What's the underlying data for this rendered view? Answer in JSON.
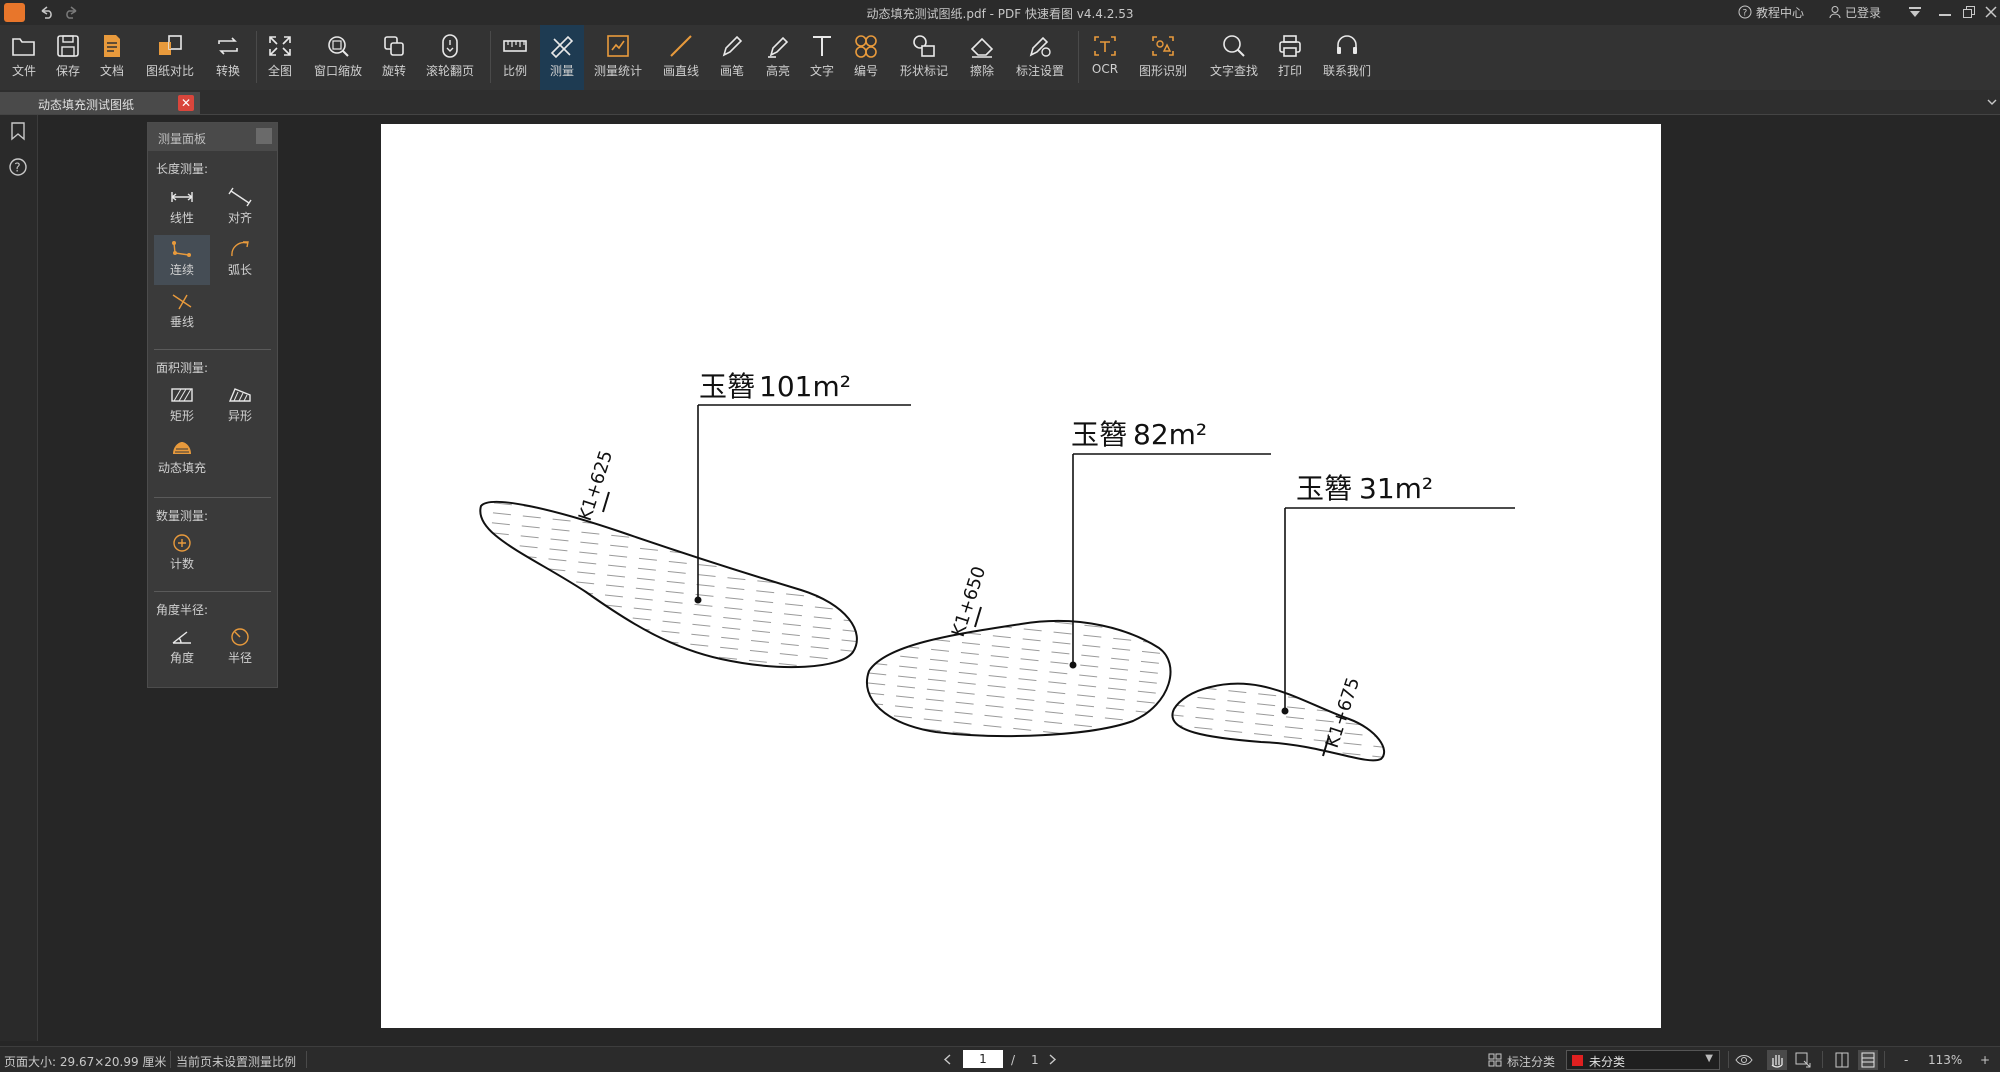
{
  "app": {
    "title": "动态填充测试图纸.pdf - PDF 快速看图 v4.4.2.53",
    "tutorial_label": "教程中心",
    "login_label": "已登录"
  },
  "toolbar": {
    "items": [
      {
        "label": "文件",
        "icon": "folder-icon"
      },
      {
        "label": "保存",
        "icon": "save-icon"
      },
      {
        "label": "文档",
        "icon": "document-icon"
      },
      {
        "label": "图纸对比",
        "icon": "compare-icon"
      },
      {
        "label": "转换",
        "icon": "convert-icon"
      },
      {
        "label": "全图",
        "icon": "fit-all-icon"
      },
      {
        "label": "窗口缩放",
        "icon": "zoom-window-icon"
      },
      {
        "label": "旋转",
        "icon": "rotate-icon"
      },
      {
        "label": "滚轮翻页",
        "icon": "mouse-wheel-icon"
      },
      {
        "label": "比例",
        "icon": "ruler-icon"
      },
      {
        "label": "测量",
        "icon": "measure-icon"
      },
      {
        "label": "测量统计",
        "icon": "measure-stats-icon"
      },
      {
        "label": "画直线",
        "icon": "line-icon"
      },
      {
        "label": "画笔",
        "icon": "pen-icon"
      },
      {
        "label": "高亮",
        "icon": "highlighter-icon"
      },
      {
        "label": "文字",
        "icon": "text-icon"
      },
      {
        "label": "编号",
        "icon": "numbering-icon"
      },
      {
        "label": "形状标记",
        "icon": "shape-mark-icon"
      },
      {
        "label": "擦除",
        "icon": "eraser-icon"
      },
      {
        "label": "标注设置",
        "icon": "annotation-settings-icon"
      },
      {
        "label": "OCR",
        "icon": "ocr-icon"
      },
      {
        "label": "图形识别",
        "icon": "shape-recognition-icon"
      },
      {
        "label": "文字查找",
        "icon": "search-icon"
      },
      {
        "label": "打印",
        "icon": "print-icon"
      },
      {
        "label": "联系我们",
        "icon": "headset-icon"
      }
    ],
    "active": "测量"
  },
  "tab": {
    "label": "动态填充测试图纸"
  },
  "panel": {
    "title": "测量面板",
    "sections": {
      "length": "长度测量:",
      "area": "面积测量:",
      "count": "数量测量:",
      "angle": "角度半径:"
    },
    "buttons": {
      "linear": "线性",
      "aligned": "对齐",
      "continuous": "连续",
      "arc": "弧长",
      "perpendicular": "垂线",
      "rectangle": "矩形",
      "irregular": "异形",
      "dynamic_fill": "动态填充",
      "count": "计数",
      "angle": "角度",
      "radius": "半径"
    },
    "selected": "连续"
  },
  "drawing": {
    "labels": [
      {
        "name": "玉簪",
        "area": "101m²"
      },
      {
        "name": "玉簪",
        "area": "82m²"
      },
      {
        "name": "玉簪",
        "area": "31m²"
      }
    ],
    "stations": [
      "K1+625",
      "K1+650",
      "K1+675"
    ]
  },
  "status": {
    "page_size": "页面大小: 29.67×20.99 厘米",
    "scale_note": "当前页未设置测量比例",
    "current_page": "1",
    "page_sep": "/",
    "total_pages": "1",
    "category_label": "标注分类",
    "category_value": "未分类",
    "category_color": "#e02020",
    "zoom": "113%",
    "zoom_minus": "-",
    "zoom_plus": "+"
  },
  "colors": {
    "accent": "#1e3b52",
    "toolbar_bg": "#333333",
    "canvas_bg": "#ffffff",
    "icon_orange": "#e89a3c"
  }
}
